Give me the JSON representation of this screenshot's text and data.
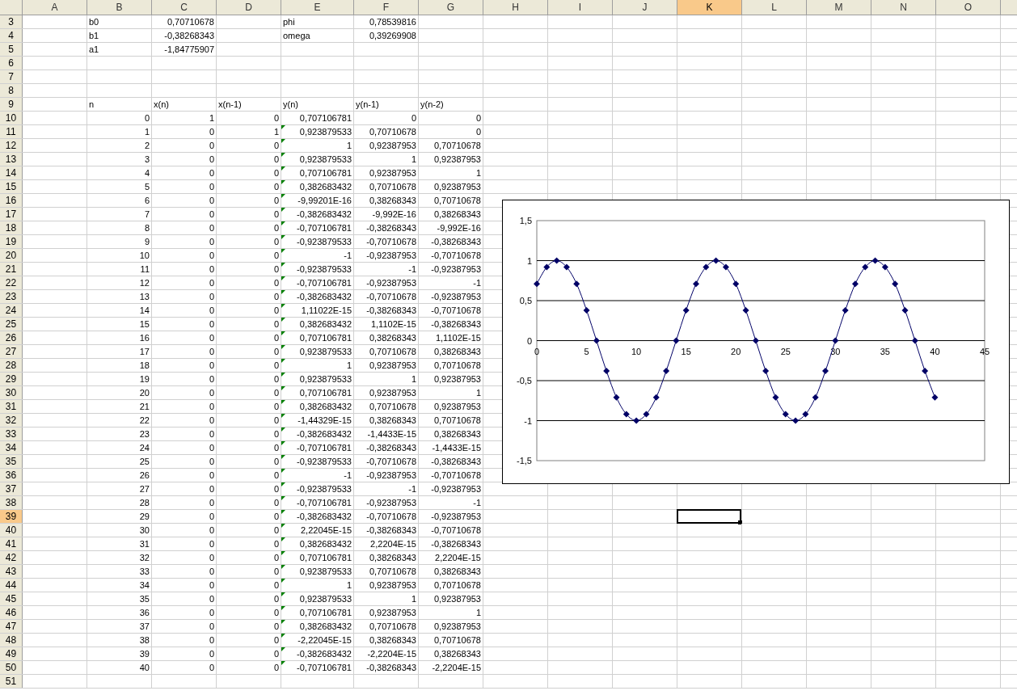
{
  "sheet": {
    "columns": [
      {
        "label": "A",
        "selected": false
      },
      {
        "label": "B",
        "selected": false
      },
      {
        "label": "C",
        "selected": false
      },
      {
        "label": "D",
        "selected": false
      },
      {
        "label": "E",
        "selected": false
      },
      {
        "label": "F",
        "selected": false
      },
      {
        "label": "G",
        "selected": false
      },
      {
        "label": "H",
        "selected": false
      },
      {
        "label": "I",
        "selected": false
      },
      {
        "label": "J",
        "selected": false
      },
      {
        "label": "K",
        "selected": true
      },
      {
        "label": "L",
        "selected": false
      },
      {
        "label": "M",
        "selected": false
      },
      {
        "label": "N",
        "selected": false
      },
      {
        "label": "O",
        "selected": false
      }
    ],
    "rows": [
      {
        "row": "3",
        "selected": false,
        "flag": false,
        "labels": {
          "B": "b0",
          "E": "phi"
        },
        "values": {
          "C": "0,70710678",
          "F": "0,78539816"
        }
      },
      {
        "row": "4",
        "selected": false,
        "flag": false,
        "labels": {
          "B": "b1",
          "E": "omega"
        },
        "values": {
          "C": "-0,38268343",
          "F": "0,39269908"
        }
      },
      {
        "row": "5",
        "selected": false,
        "flag": false,
        "labels": {
          "B": "a1"
        },
        "values": {
          "C": "-1,84775907"
        }
      },
      {
        "row": "6",
        "selected": false,
        "flag": false
      },
      {
        "row": "7",
        "selected": false,
        "flag": false
      },
      {
        "row": "8",
        "selected": false,
        "flag": false
      },
      {
        "row": "9",
        "selected": false,
        "flag": false,
        "labels": {
          "B": "n",
          "C": "x(n)",
          "D": "x(n-1)",
          "E": "y(n)",
          "F": "y(n-1)",
          "G": "y(n-2)"
        }
      },
      {
        "row": "10",
        "selected": false,
        "flag": false,
        "values": {
          "B": "0",
          "C": "1",
          "D": "0",
          "E": "0,707106781",
          "F": "0",
          "G": "0"
        }
      },
      {
        "row": "11",
        "selected": false,
        "flag": true,
        "values": {
          "B": "1",
          "C": "0",
          "D": "1",
          "E": "0,923879533",
          "F": "0,70710678",
          "G": "0"
        }
      },
      {
        "row": "12",
        "selected": false,
        "flag": true,
        "values": {
          "B": "2",
          "C": "0",
          "D": "0",
          "E": "1",
          "F": "0,92387953",
          "G": "0,70710678"
        }
      },
      {
        "row": "13",
        "selected": false,
        "flag": true,
        "values": {
          "B": "3",
          "C": "0",
          "D": "0",
          "E": "0,923879533",
          "F": "1",
          "G": "0,92387953"
        }
      },
      {
        "row": "14",
        "selected": false,
        "flag": true,
        "values": {
          "B": "4",
          "C": "0",
          "D": "0",
          "E": "0,707106781",
          "F": "0,92387953",
          "G": "1"
        }
      },
      {
        "row": "15",
        "selected": false,
        "flag": true,
        "values": {
          "B": "5",
          "C": "0",
          "D": "0",
          "E": "0,382683432",
          "F": "0,70710678",
          "G": "0,92387953"
        }
      },
      {
        "row": "16",
        "selected": false,
        "flag": true,
        "values": {
          "B": "6",
          "C": "0",
          "D": "0",
          "E": "-9,99201E-16",
          "F": "0,38268343",
          "G": "0,70710678"
        }
      },
      {
        "row": "17",
        "selected": false,
        "flag": true,
        "values": {
          "B": "7",
          "C": "0",
          "D": "0",
          "E": "-0,382683432",
          "F": "-9,992E-16",
          "G": "0,38268343"
        }
      },
      {
        "row": "18",
        "selected": false,
        "flag": true,
        "values": {
          "B": "8",
          "C": "0",
          "D": "0",
          "E": "-0,707106781",
          "F": "-0,38268343",
          "G": "-9,992E-16"
        }
      },
      {
        "row": "19",
        "selected": false,
        "flag": true,
        "values": {
          "B": "9",
          "C": "0",
          "D": "0",
          "E": "-0,923879533",
          "F": "-0,70710678",
          "G": "-0,38268343"
        }
      },
      {
        "row": "20",
        "selected": false,
        "flag": true,
        "values": {
          "B": "10",
          "C": "0",
          "D": "0",
          "E": "-1",
          "F": "-0,92387953",
          "G": "-0,70710678"
        }
      },
      {
        "row": "21",
        "selected": false,
        "flag": true,
        "values": {
          "B": "11",
          "C": "0",
          "D": "0",
          "E": "-0,923879533",
          "F": "-1",
          "G": "-0,92387953"
        }
      },
      {
        "row": "22",
        "selected": false,
        "flag": true,
        "values": {
          "B": "12",
          "C": "0",
          "D": "0",
          "E": "-0,707106781",
          "F": "-0,92387953",
          "G": "-1"
        }
      },
      {
        "row": "23",
        "selected": false,
        "flag": true,
        "values": {
          "B": "13",
          "C": "0",
          "D": "0",
          "E": "-0,382683432",
          "F": "-0,70710678",
          "G": "-0,92387953"
        }
      },
      {
        "row": "24",
        "selected": false,
        "flag": true,
        "values": {
          "B": "14",
          "C": "0",
          "D": "0",
          "E": "1,11022E-15",
          "F": "-0,38268343",
          "G": "-0,70710678"
        }
      },
      {
        "row": "25",
        "selected": false,
        "flag": true,
        "values": {
          "B": "15",
          "C": "0",
          "D": "0",
          "E": "0,382683432",
          "F": "1,1102E-15",
          "G": "-0,38268343"
        }
      },
      {
        "row": "26",
        "selected": false,
        "flag": true,
        "values": {
          "B": "16",
          "C": "0",
          "D": "0",
          "E": "0,707106781",
          "F": "0,38268343",
          "G": "1,1102E-15"
        }
      },
      {
        "row": "27",
        "selected": false,
        "flag": true,
        "values": {
          "B": "17",
          "C": "0",
          "D": "0",
          "E": "0,923879533",
          "F": "0,70710678",
          "G": "0,38268343"
        }
      },
      {
        "row": "28",
        "selected": false,
        "flag": true,
        "values": {
          "B": "18",
          "C": "0",
          "D": "0",
          "E": "1",
          "F": "0,92387953",
          "G": "0,70710678"
        }
      },
      {
        "row": "29",
        "selected": false,
        "flag": true,
        "values": {
          "B": "19",
          "C": "0",
          "D": "0",
          "E": "0,923879533",
          "F": "1",
          "G": "0,92387953"
        }
      },
      {
        "row": "30",
        "selected": false,
        "flag": true,
        "values": {
          "B": "20",
          "C": "0",
          "D": "0",
          "E": "0,707106781",
          "F": "0,92387953",
          "G": "1"
        }
      },
      {
        "row": "31",
        "selected": false,
        "flag": true,
        "values": {
          "B": "21",
          "C": "0",
          "D": "0",
          "E": "0,382683432",
          "F": "0,70710678",
          "G": "0,92387953"
        }
      },
      {
        "row": "32",
        "selected": false,
        "flag": true,
        "values": {
          "B": "22",
          "C": "0",
          "D": "0",
          "E": "-1,44329E-15",
          "F": "0,38268343",
          "G": "0,70710678"
        }
      },
      {
        "row": "33",
        "selected": false,
        "flag": true,
        "values": {
          "B": "23",
          "C": "0",
          "D": "0",
          "E": "-0,382683432",
          "F": "-1,4433E-15",
          "G": "0,38268343"
        }
      },
      {
        "row": "34",
        "selected": false,
        "flag": true,
        "values": {
          "B": "24",
          "C": "0",
          "D": "0",
          "E": "-0,707106781",
          "F": "-0,38268343",
          "G": "-1,4433E-15"
        }
      },
      {
        "row": "35",
        "selected": false,
        "flag": true,
        "values": {
          "B": "25",
          "C": "0",
          "D": "0",
          "E": "-0,923879533",
          "F": "-0,70710678",
          "G": "-0,38268343"
        }
      },
      {
        "row": "36",
        "selected": false,
        "flag": true,
        "values": {
          "B": "26",
          "C": "0",
          "D": "0",
          "E": "-1",
          "F": "-0,92387953",
          "G": "-0,70710678"
        }
      },
      {
        "row": "37",
        "selected": false,
        "flag": true,
        "values": {
          "B": "27",
          "C": "0",
          "D": "0",
          "E": "-0,923879533",
          "F": "-1",
          "G": "-0,92387953"
        }
      },
      {
        "row": "38",
        "selected": false,
        "flag": true,
        "values": {
          "B": "28",
          "C": "0",
          "D": "0",
          "E": "-0,707106781",
          "F": "-0,92387953",
          "G": "-1"
        }
      },
      {
        "row": "39",
        "selected": true,
        "flag": true,
        "values": {
          "B": "29",
          "C": "0",
          "D": "0",
          "E": "-0,382683432",
          "F": "-0,70710678",
          "G": "-0,92387953"
        }
      },
      {
        "row": "40",
        "selected": false,
        "flag": true,
        "values": {
          "B": "30",
          "C": "0",
          "D": "0",
          "E": "2,22045E-15",
          "F": "-0,38268343",
          "G": "-0,70710678"
        }
      },
      {
        "row": "41",
        "selected": false,
        "flag": true,
        "values": {
          "B": "31",
          "C": "0",
          "D": "0",
          "E": "0,382683432",
          "F": "2,2204E-15",
          "G": "-0,38268343"
        }
      },
      {
        "row": "42",
        "selected": false,
        "flag": true,
        "values": {
          "B": "32",
          "C": "0",
          "D": "0",
          "E": "0,707106781",
          "F": "0,38268343",
          "G": "2,2204E-15"
        }
      },
      {
        "row": "43",
        "selected": false,
        "flag": true,
        "values": {
          "B": "33",
          "C": "0",
          "D": "0",
          "E": "0,923879533",
          "F": "0,70710678",
          "G": "0,38268343"
        }
      },
      {
        "row": "44",
        "selected": false,
        "flag": true,
        "values": {
          "B": "34",
          "C": "0",
          "D": "0",
          "E": "1",
          "F": "0,92387953",
          "G": "0,70710678"
        }
      },
      {
        "row": "45",
        "selected": false,
        "flag": true,
        "values": {
          "B": "35",
          "C": "0",
          "D": "0",
          "E": "0,923879533",
          "F": "1",
          "G": "0,92387953"
        }
      },
      {
        "row": "46",
        "selected": false,
        "flag": true,
        "values": {
          "B": "36",
          "C": "0",
          "D": "0",
          "E": "0,707106781",
          "F": "0,92387953",
          "G": "1"
        }
      },
      {
        "row": "47",
        "selected": false,
        "flag": true,
        "values": {
          "B": "37",
          "C": "0",
          "D": "0",
          "E": "0,382683432",
          "F": "0,70710678",
          "G": "0,92387953"
        }
      },
      {
        "row": "48",
        "selected": false,
        "flag": true,
        "values": {
          "B": "38",
          "C": "0",
          "D": "0",
          "E": "-2,22045E-15",
          "F": "0,38268343",
          "G": "0,70710678"
        }
      },
      {
        "row": "49",
        "selected": false,
        "flag": true,
        "values": {
          "B": "39",
          "C": "0",
          "D": "0",
          "E": "-0,382683432",
          "F": "-2,2204E-15",
          "G": "0,38268343"
        }
      },
      {
        "row": "50",
        "selected": false,
        "flag": true,
        "values": {
          "B": "40",
          "C": "0",
          "D": "0",
          "E": "-0,707106781",
          "F": "-0,38268343",
          "G": "-2,2204E-15"
        }
      },
      {
        "row": "51",
        "selected": false,
        "flag": false
      }
    ]
  },
  "chart": {
    "chart_data": {
      "type": "line",
      "x": [
        0,
        1,
        2,
        3,
        4,
        5,
        6,
        7,
        8,
        9,
        10,
        11,
        12,
        13,
        14,
        15,
        16,
        17,
        18,
        19,
        20,
        21,
        22,
        23,
        24,
        25,
        26,
        27,
        28,
        29,
        30,
        31,
        32,
        33,
        34,
        35,
        36,
        37,
        38,
        39,
        40
      ],
      "grid": true,
      "series": [
        {
          "color": "#000066",
          "marker": "diamond",
          "values": [
            0.71,
            0.92,
            1,
            0.92,
            0.71,
            0.38,
            0,
            -0.38,
            -0.71,
            -0.92,
            -1,
            -0.92,
            -0.71,
            -0.38,
            0,
            0.38,
            0.71,
            0.92,
            1,
            0.92,
            0.71,
            0.38,
            0,
            -0.38,
            -0.71,
            -0.92,
            -1,
            -0.92,
            -0.71,
            -0.38,
            0,
            0.38,
            0.71,
            0.92,
            1,
            0.92,
            0.71,
            0.38,
            0,
            -0.38,
            -0.71
          ]
        }
      ],
      "xlim": [
        0,
        45
      ],
      "ylim": [
        -1.5,
        1.5
      ],
      "xticks": [
        0,
        5,
        10,
        15,
        20,
        25,
        30,
        35,
        40,
        45
      ],
      "yticks": [
        {
          "value": -1.5,
          "label": "-1,5"
        },
        {
          "value": -1,
          "label": "-1"
        },
        {
          "value": -0.5,
          "label": "-0,5"
        },
        {
          "value": 0,
          "label": "0"
        },
        {
          "value": 0.5,
          "label": "0,5"
        },
        {
          "value": 1,
          "label": "1"
        },
        {
          "value": 1.5,
          "label": "1,5"
        }
      ]
    }
  }
}
